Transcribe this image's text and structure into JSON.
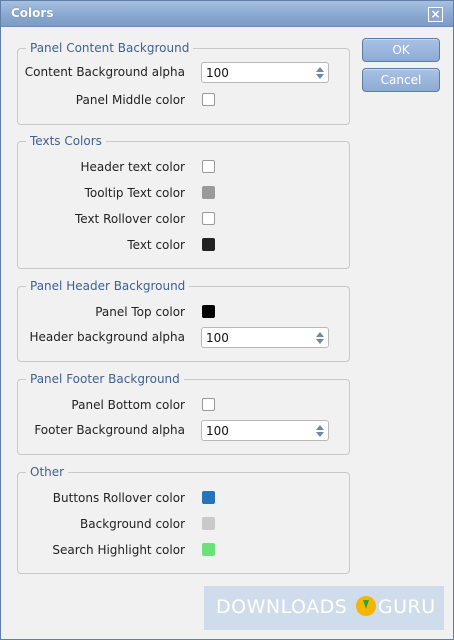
{
  "window": {
    "title": "Colors",
    "close_glyph": "×"
  },
  "buttons": {
    "ok": "OK",
    "cancel": "Cancel"
  },
  "groups": [
    {
      "title": "Panel Content Background",
      "rows": [
        {
          "label": "Content Background alpha",
          "type": "spin",
          "value": "100"
        },
        {
          "label": "Panel Middle color",
          "type": "color",
          "color": "#ffffff"
        }
      ]
    },
    {
      "title": "Texts Colors",
      "rows": [
        {
          "label": "Header text color",
          "type": "color",
          "color": "#ffffff"
        },
        {
          "label": "Tooltip Text color",
          "type": "color",
          "color": "#9a9a9a"
        },
        {
          "label": "Text Rollover color",
          "type": "color",
          "color": "#ffffff"
        },
        {
          "label": "Text color",
          "type": "color",
          "color": "#222222"
        }
      ]
    },
    {
      "title": "Panel Header Background",
      "rows": [
        {
          "label": "Panel Top color",
          "type": "color",
          "color": "#000000"
        },
        {
          "label": "Header background alpha",
          "type": "spin",
          "value": "100"
        }
      ]
    },
    {
      "title": "Panel Footer Background",
      "rows": [
        {
          "label": "Panel Bottom color",
          "type": "color",
          "color": "#ffffff"
        },
        {
          "label": "Footer Background alpha",
          "type": "spin",
          "value": "100"
        }
      ]
    },
    {
      "title": "Other",
      "rows": [
        {
          "label": "Buttons Rollover color",
          "type": "color",
          "color": "#2574b8"
        },
        {
          "label": "Background color",
          "type": "color",
          "color": "#c9c9c9"
        },
        {
          "label": "Search Highlight color",
          "type": "color",
          "color": "#6ee07a"
        }
      ]
    }
  ],
  "watermark": {
    "left": "DOWNLOADS",
    "right": "GURU"
  }
}
